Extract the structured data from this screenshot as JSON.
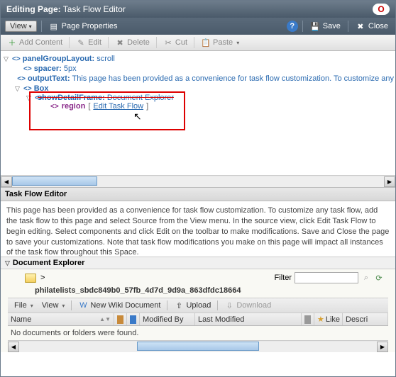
{
  "title": {
    "prefix": "Editing Page:",
    "name": "Task Flow Editor"
  },
  "menubar": {
    "view": "View",
    "page_props": "Page Properties",
    "save": "Save",
    "close": "Close"
  },
  "toolbar": {
    "add_content": "Add Content",
    "edit": "Edit",
    "delete": "Delete",
    "cut": "Cut",
    "paste": "Paste"
  },
  "tree": {
    "n1": {
      "name": "panelGroupLayout:",
      "val": "scroll"
    },
    "n2": {
      "name": "spacer:",
      "val": "5px"
    },
    "n3": {
      "name": "outputText:",
      "val": "This page has been provided as a convenience for task flow customization. To customize any"
    },
    "n4": {
      "name": "Box",
      "val": ""
    },
    "n5": {
      "name": "showDetailFrame:",
      "val": "Document Explorer"
    },
    "region": {
      "label": "region",
      "open": "[",
      "link": "Edit Task Flow",
      "close": "]"
    }
  },
  "panel": {
    "title": "Task Flow Editor",
    "body": "This page has been provided as a convenience for task flow customization. To customize any task flow, add the task flow to this page and select Source from the View menu. In the source view, click Edit Task Flow to begin editing. Select components and click Edit on the toolbar to make modifications. Save and Close the page to save your customizations. Note that task flow modifications you make on this page will impact all instances of the task flow throughout this Space."
  },
  "doc": {
    "title": "Document Explorer",
    "bc_sep": ">",
    "filter_label": "Filter",
    "path": "philatelists_sbdc849b0_57fb_4d7d_9d9a_863dfdc18664",
    "file": "File",
    "view": "View",
    "new_wiki": "New Wiki Document",
    "upload": "Upload",
    "download": "Download",
    "cols": {
      "name": "Name",
      "modby": "Modified By",
      "lastmod": "Last Modified",
      "like": "Like",
      "descr": "Descri"
    },
    "empty": "No documents or folders were found.",
    "sort_glyph": "▲▼"
  }
}
